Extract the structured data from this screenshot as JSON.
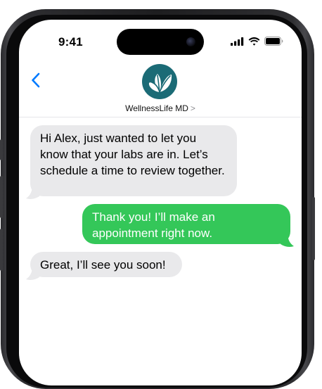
{
  "status_bar": {
    "time": "9:41",
    "signal_icon": "cellular-signal-icon",
    "wifi_icon": "wifi-icon",
    "battery_icon": "battery-icon"
  },
  "header": {
    "back_icon": "chevron-left-icon",
    "contact_name": "WellnessLife MD",
    "contact_chevron": ">",
    "avatar_icon": "leaf-logo-icon"
  },
  "messages": [
    {
      "direction": "incoming",
      "text": "Hi Alex, just wanted to let you know that your labs are in. Let’s schedule a time to review together."
    },
    {
      "direction": "outgoing",
      "text": "Thank you! I’ll make an appointment right now."
    },
    {
      "direction": "incoming",
      "text": "Great, I’ll see you soon!"
    }
  ],
  "colors": {
    "incoming_bubble": "#e9e9eb",
    "outgoing_bubble": "#34c759",
    "accent": "#007aff",
    "avatar": "#1b6b76"
  }
}
